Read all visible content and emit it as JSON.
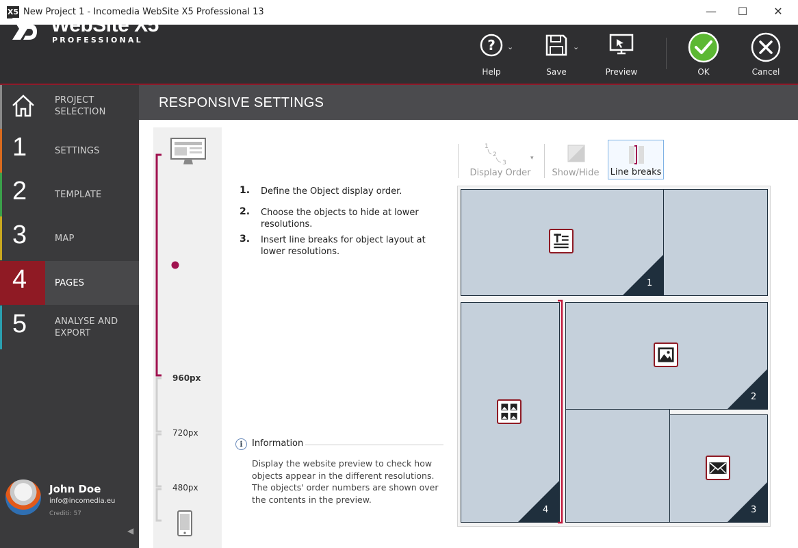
{
  "window": {
    "app_icon_glyph": "X5",
    "title": "New Project 1 - Incomedia WebSite X5 Professional 13",
    "minimize": "—",
    "maximize": "☐",
    "close": "✕"
  },
  "header": {
    "logo_text": "WebSite X5",
    "logo_subtitle": "PROFESSIONAL",
    "buttons": [
      {
        "label": "Help",
        "icon": "help-icon"
      },
      {
        "label": "Save",
        "icon": "save-icon"
      },
      {
        "label": "Preview",
        "icon": "preview-icon"
      },
      {
        "label": "OK",
        "icon": "ok-icon"
      },
      {
        "label": "Cancel",
        "icon": "cancel-icon"
      }
    ],
    "chevron": "⌄"
  },
  "sidebar": {
    "items": [
      {
        "num": "",
        "label_line1": "PROJECT",
        "label_line2": "SELECTION",
        "color": "#8a8a8a"
      },
      {
        "num": "1",
        "label_line1": "SETTINGS",
        "label_line2": "",
        "color": "#d96a1e"
      },
      {
        "num": "2",
        "label_line1": "TEMPLATE",
        "label_line2": "",
        "color": "#3aa04a"
      },
      {
        "num": "3",
        "label_line1": "MAP",
        "label_line2": "",
        "color": "#c9a81f"
      },
      {
        "num": "4",
        "label_line1": "PAGES",
        "label_line2": "",
        "color": "#8f1a24"
      },
      {
        "num": "5",
        "label_line1": "ANALYSE AND",
        "label_line2": "EXPORT",
        "color": "#2aa0b0"
      }
    ],
    "user": {
      "name": "John Doe",
      "email": "info@incomedia.eu",
      "credits": "Crediti: 57"
    },
    "collapse_glyph": "◀"
  },
  "section": {
    "title": "RESPONSIVE SETTINGS"
  },
  "resolutions": {
    "r960": "960px",
    "r720": "720px",
    "r480": "480px"
  },
  "instructions": [
    {
      "num": "1.",
      "text": "Define the Object display order."
    },
    {
      "num": "2.",
      "text": "Choose the objects to hide at lower resolutions."
    },
    {
      "num": "3.",
      "text": "Insert line breaks for object layout at lower resolutions."
    }
  ],
  "info": {
    "icon_glyph": "i",
    "title": "Information",
    "text": "Display the website preview to check how objects appear in the different resolutions. The objects' order numbers are shown over the contents in the preview."
  },
  "toolbar": {
    "display_order": "Display Order",
    "display_order_digits": [
      "1",
      "2",
      "3"
    ],
    "show_hide": "Show/Hide",
    "line_breaks": "Line breaks",
    "dropdown_glyph": "▾"
  },
  "preview": {
    "blocks": [
      {
        "order": "1",
        "icon": "text-object-icon"
      },
      {
        "order": "2",
        "icon": "image-object-icon"
      },
      {
        "order": "3",
        "icon": "email-object-icon"
      },
      {
        "order": "4",
        "icon": "gallery-object-icon"
      }
    ]
  },
  "colors": {
    "accent": "#8f1a24",
    "rail_accent": "#a0124f",
    "header_bg": "#2f2f31",
    "ok_green": "#5cb833",
    "block_fill": "#c5d0db",
    "corner_fill": "#1f2f3d"
  }
}
